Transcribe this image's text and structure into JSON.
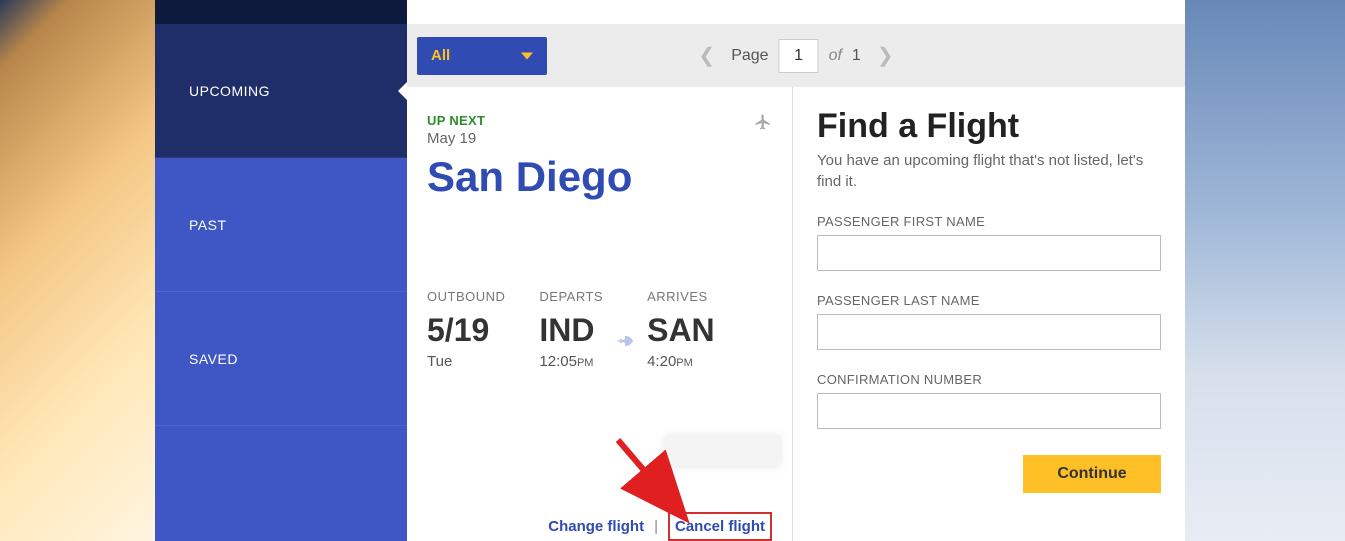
{
  "sidebar": {
    "items": [
      {
        "label": "UPCOMING"
      },
      {
        "label": "PAST"
      },
      {
        "label": "SAVED"
      }
    ]
  },
  "filter": {
    "selected": "All"
  },
  "pagination": {
    "page_label": "Page",
    "current": "1",
    "of_label": "of",
    "total": "1"
  },
  "flight": {
    "upnext_label": "UP NEXT",
    "upnext_date": "May 19",
    "destination": "San Diego",
    "outbound_label": "OUTBOUND",
    "outbound_date": "5/19",
    "outbound_day": "Tue",
    "departs_label": "DEPARTS",
    "departs_code": "IND",
    "departs_time": "12:05",
    "departs_ampm": "PM",
    "arrives_label": "ARRIVES",
    "arrives_code": "SAN",
    "arrives_time": "4:20",
    "arrives_ampm": "PM",
    "change_label": "Change flight",
    "cancel_label": "Cancel flight"
  },
  "find": {
    "title": "Find a Flight",
    "subtitle": "You have an upcoming flight that's not listed, let's find it.",
    "first_name_label": "PASSENGER FIRST NAME",
    "last_name_label": "PASSENGER LAST NAME",
    "confirmation_label": "CONFIRMATION NUMBER",
    "continue_label": "Continue"
  }
}
